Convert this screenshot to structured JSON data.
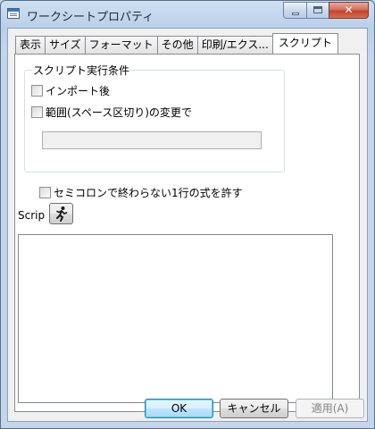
{
  "window": {
    "title": "ワークシートプロパティ"
  },
  "tabs": [
    {
      "label": "表示"
    },
    {
      "label": "サイズ"
    },
    {
      "label": "フォーマット"
    },
    {
      "label": "その他"
    },
    {
      "label": "印刷/エクス..."
    },
    {
      "label": "スクリプト"
    }
  ],
  "active_tab": "スクリプト",
  "script_conditions": {
    "group_label": "スクリプト実行条件",
    "after_import": {
      "label": "インポート後",
      "checked": false
    },
    "on_range_change": {
      "label": "範囲(スペース区切り)の変更で",
      "checked": false
    },
    "range_value": ""
  },
  "allow_single_line": {
    "label": "セミコロンで終わらない1行の式を許す",
    "checked": false
  },
  "script": {
    "label": "Scrip",
    "run_icon": "running-man-icon",
    "content": ""
  },
  "footer": {
    "ok_label": "OK",
    "cancel_label": "キャンセル",
    "apply_label": "適用(A)"
  }
}
